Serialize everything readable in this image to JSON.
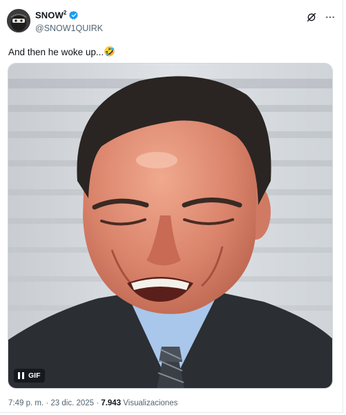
{
  "author": {
    "display_name": "SNOW",
    "display_name_sup": "2",
    "handle": "@SNOW1QUIRK"
  },
  "tweet": {
    "text": "And then he woke up...",
    "emoji": "🤣"
  },
  "media": {
    "badge_label": "GIF"
  },
  "meta": {
    "time": "7:49 p. m.",
    "separator": "·",
    "date": "23 dic. 2025",
    "views_count": "7.943",
    "views_label": "Visualizaciones"
  },
  "colors": {
    "verified_blue": "#1d9bf0",
    "secondary_text": "#536471"
  },
  "icons": [
    "grok-icon",
    "more-options-icon",
    "verified-badge-icon",
    "pause-icon"
  ]
}
